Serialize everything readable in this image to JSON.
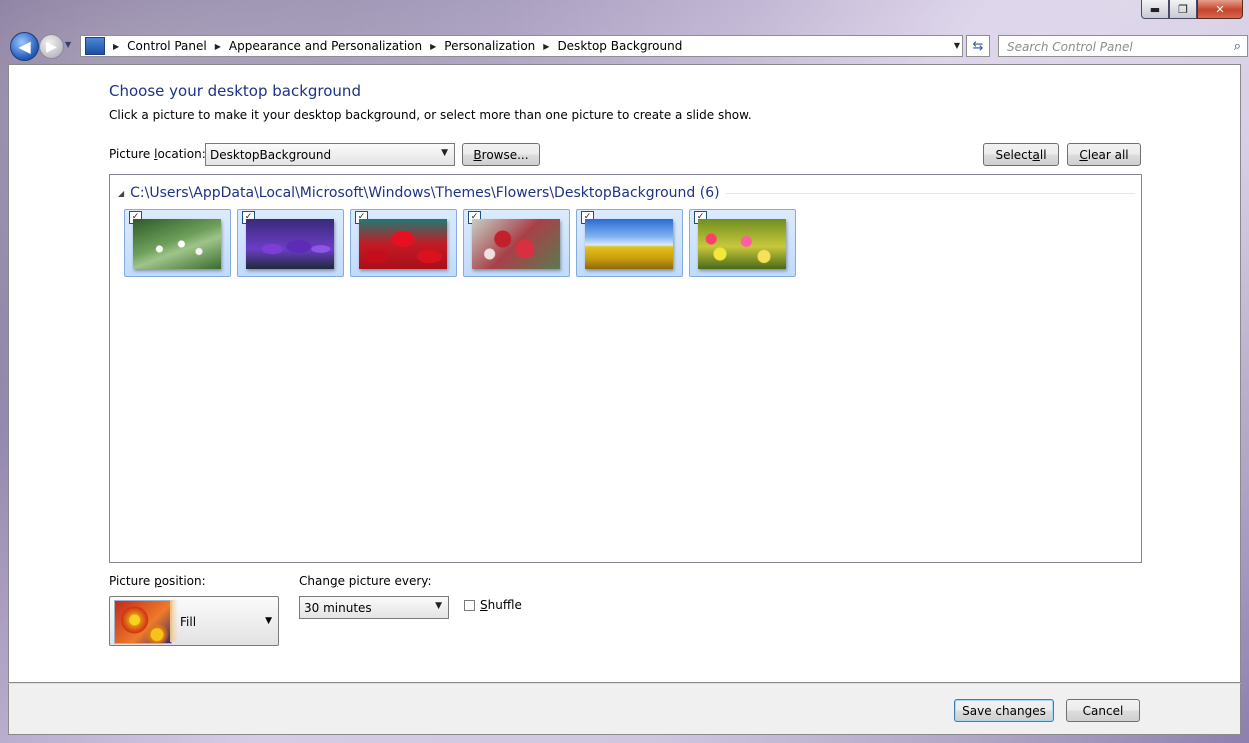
{
  "window": {
    "caption_buttons": {
      "minimize_glyph": "▬",
      "maximize_glyph": "❐",
      "close_glyph": "✕"
    }
  },
  "nav": {
    "back_icon": "◀",
    "forward_icon": "▶",
    "history_drop_icon": "▼",
    "breadcrumb": [
      {
        "label": "Control Panel"
      },
      {
        "label": "Appearance and Personalization"
      },
      {
        "label": "Personalization"
      },
      {
        "label": "Desktop Background"
      }
    ],
    "crumb_sep_icon": "▶",
    "address_drop_icon": "▼",
    "refresh_icon": "⇆",
    "search": {
      "placeholder": "Search Control Panel",
      "icon": "⌕"
    }
  },
  "main": {
    "title": "Choose your desktop background",
    "subtitle": "Click a picture to make it your desktop background, or select more than one picture to create a slide show.",
    "picture_location": {
      "label_pre": "Picture ",
      "label_u": "l",
      "label_post": "ocation:",
      "value": "DesktopBackground",
      "browse_pre": "",
      "browse_u": "B",
      "browse_post": "rowse..."
    },
    "select_all_pre": "Select ",
    "select_all_u": "a",
    "select_all_post": "ll",
    "clear_all_pre": "",
    "clear_all_u": "C",
    "clear_all_post": "lear all",
    "group": {
      "expand_icon": "◢",
      "heading": "C:\\Users\\AppData\\Local\\Microsoft\\Windows\\Themes\\Flowers\\DesktopBackground (6)",
      "images": [
        {
          "name": "white-daisies",
          "checked": true
        },
        {
          "name": "purple-crocuses",
          "checked": true
        },
        {
          "name": "red-tulips",
          "checked": true
        },
        {
          "name": "red-flower-cluster",
          "checked": true
        },
        {
          "name": "sunflower-field-sky",
          "checked": true
        },
        {
          "name": "colorful-wildflowers",
          "checked": true
        }
      ],
      "check_glyph": "✓"
    },
    "picture_position": {
      "label_pre": "Picture ",
      "label_u": "p",
      "label_post": "osition:",
      "value": "Fill"
    },
    "change_every": {
      "label_pre": "Chan",
      "label_u": "g",
      "label_post": "e picture every:",
      "value": "30 minutes"
    },
    "shuffle": {
      "label_u": "S",
      "label_post": "huffle",
      "checked": false
    }
  },
  "footer": {
    "save_label": "Save changes",
    "cancel_label": "Cancel"
  },
  "colors": {
    "heading_blue": "#1e3287",
    "selection_fill": "#c1dbfc",
    "selection_border": "#84acdd"
  }
}
